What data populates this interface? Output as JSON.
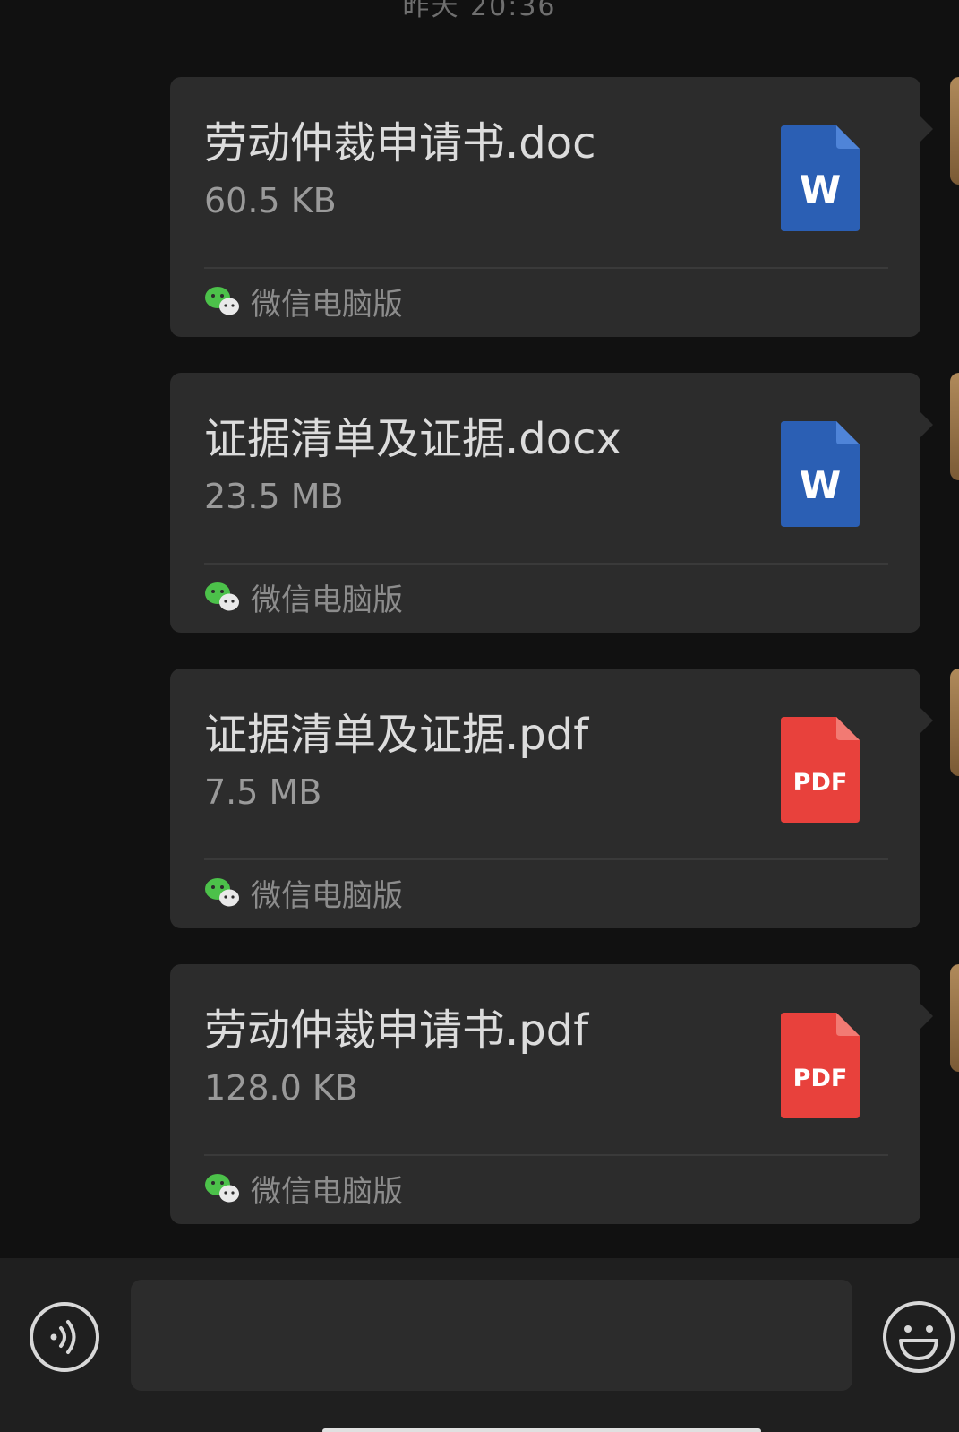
{
  "chat": {
    "timestamp": "昨天 20:36",
    "messages": [
      {
        "file_name": "劳动仲裁申请书.doc",
        "file_size": "60.5 KB",
        "file_type": "word",
        "icon_label": "W",
        "icon_color": "#2b5fb4",
        "source": "微信电脑版"
      },
      {
        "file_name": "证据清单及证据.docx",
        "file_size": "23.5 MB",
        "file_type": "word",
        "icon_label": "W",
        "icon_color": "#2b5fb4",
        "source": "微信电脑版"
      },
      {
        "file_name": "证据清单及证据.pdf",
        "file_size": "7.5 MB",
        "file_type": "pdf",
        "icon_label": "PDF",
        "icon_color": "#e8413c",
        "source": "微信电脑版"
      },
      {
        "file_name": "劳动仲裁申请书.pdf",
        "file_size": "128.0 KB",
        "file_type": "pdf",
        "icon_label": "PDF",
        "icon_color": "#e8413c",
        "source": "微信电脑版"
      }
    ]
  },
  "input_bar": {
    "voice_icon": "voice-icon",
    "emoji_icon": "emoji-icon",
    "text_value": ""
  },
  "colors": {
    "background": "#111111",
    "bubble": "#2c2c2c",
    "wechat_green": "#4cc14a",
    "word_blue": "#2b5fb4",
    "pdf_red": "#e8413c"
  }
}
